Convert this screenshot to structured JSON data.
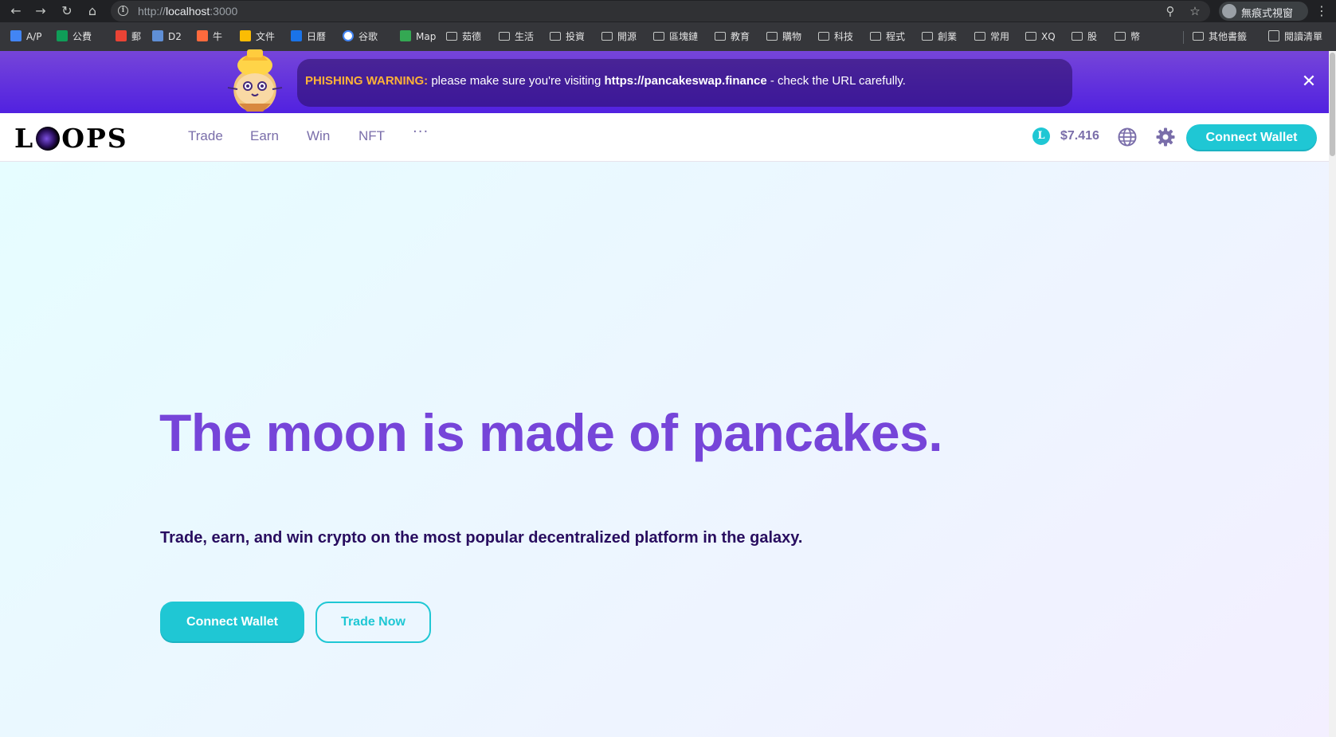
{
  "browser": {
    "url_scheme": "http://",
    "url_host": "localhost",
    "url_port": ":3000",
    "profile_label": "無痕式視窗",
    "icons": [
      "back-icon",
      "forward-icon",
      "reload-icon",
      "home-icon",
      "info-icon",
      "zoom-icon",
      "star-icon",
      "incognito-icon",
      "kebab-menu-icon"
    ]
  },
  "bookmarks": [
    {
      "label": "A/P",
      "icon": "docs",
      "color": "#4285f4"
    },
    {
      "label": "公費",
      "icon": "sheets",
      "color": "#0f9d58"
    },
    {
      "label": "郵",
      "icon": "gmail",
      "color": "#ea4335"
    },
    {
      "label": "D2",
      "icon": "d2",
      "color": "#5f8fd6"
    },
    {
      "label": "牛",
      "icon": "cow",
      "color": "#ff6a3d"
    },
    {
      "label": "文件",
      "icon": "drive",
      "color": "#fbbc04"
    },
    {
      "label": "日曆",
      "icon": "calendar",
      "color": "#1a73e8"
    },
    {
      "label": "谷歌",
      "icon": "google",
      "color": "#ffffff"
    },
    {
      "label": "Map",
      "icon": "maps",
      "color": "#34a853"
    },
    {
      "label": "茹德",
      "icon": "folder"
    },
    {
      "label": "生活",
      "icon": "folder"
    },
    {
      "label": "投資",
      "icon": "folder"
    },
    {
      "label": "開源",
      "icon": "folder"
    },
    {
      "label": "區塊鏈",
      "icon": "folder"
    },
    {
      "label": "教育",
      "icon": "folder"
    },
    {
      "label": "購物",
      "icon": "folder"
    },
    {
      "label": "科技",
      "icon": "folder"
    },
    {
      "label": "程式",
      "icon": "folder"
    },
    {
      "label": "創業",
      "icon": "folder"
    },
    {
      "label": "常用",
      "icon": "folder"
    },
    {
      "label": "XQ",
      "icon": "folder"
    },
    {
      "label": "股",
      "icon": "folder"
    },
    {
      "label": "幣",
      "icon": "folder"
    },
    {
      "label": "其他書籤",
      "icon": "folder"
    },
    {
      "label": "閱讀清單",
      "icon": "reading-list"
    }
  ],
  "banner": {
    "warning_label": "PHISHING WARNING:",
    "message": " please make sure you're visiting ",
    "link": "https://pancakeswap.finance",
    "suffix": " - check the URL carefully."
  },
  "nav": {
    "logo_left": "L",
    "logo_right": "OPS",
    "menu": [
      "Trade",
      "Earn",
      "Win",
      "NFT"
    ],
    "more": "···",
    "price_badge": "L",
    "price": "$7.416",
    "connect_label": "Connect Wallet"
  },
  "hero": {
    "title": "The moon is made of pancakes.",
    "subtitle": "Trade, earn, and win crypto on the most popular decentralized platform in the galaxy.",
    "primary_label": "Connect Wallet",
    "secondary_label": "Trade Now"
  },
  "colors": {
    "primary": "#1fc7d4",
    "secondary": "#7645d9",
    "text_dark": "#280d5f",
    "text_sub": "#7a6eaa",
    "warning": "#ffb237"
  }
}
